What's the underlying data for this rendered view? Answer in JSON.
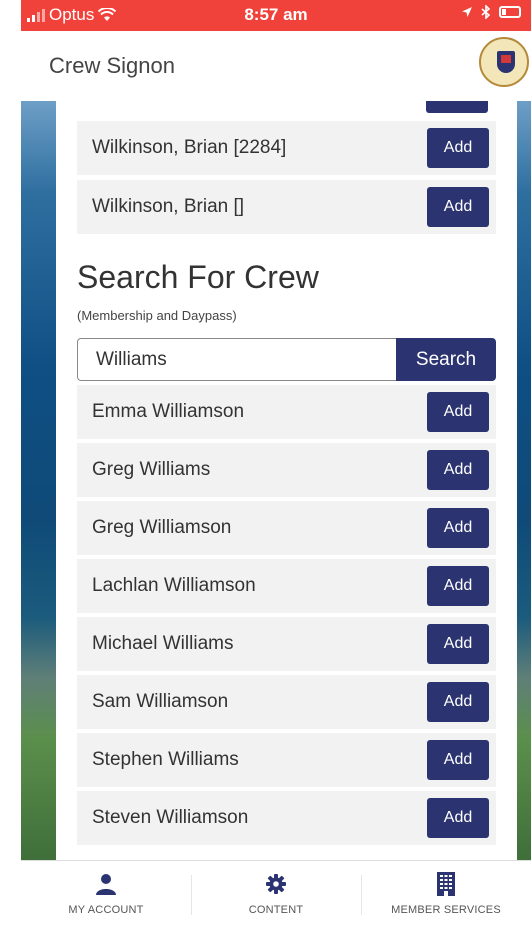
{
  "status_bar": {
    "carrier": "Optus",
    "time": "8:57 am"
  },
  "header": {
    "title": "Crew Signon",
    "logo_icon": "royal-geelong-yacht-club-logo"
  },
  "colors": {
    "status_bar": "#f0413a",
    "button": "#2b3470",
    "row_bg": "#f2f2f3"
  },
  "previous_results": [
    {
      "name": "Wilkinson, Brian [2284]",
      "action": "Add"
    },
    {
      "name": "Wilkinson, Brian []",
      "action": "Add"
    }
  ],
  "search": {
    "title": "Search For Crew",
    "subtitle": "(Membership and Daypass)",
    "query": "Williams",
    "button_label": "Search"
  },
  "results": [
    {
      "name": "Emma Williamson",
      "action": "Add"
    },
    {
      "name": "Greg Williams",
      "action": "Add"
    },
    {
      "name": "Greg Williamson",
      "action": "Add"
    },
    {
      "name": "Lachlan Williamson",
      "action": "Add"
    },
    {
      "name": "Michael Williams",
      "action": "Add"
    },
    {
      "name": "Sam Williamson",
      "action": "Add"
    },
    {
      "name": "Stephen Williams",
      "action": "Add"
    },
    {
      "name": "Steven Williamson",
      "action": "Add"
    }
  ],
  "bottom_nav": [
    {
      "label": "MY ACCOUNT",
      "icon": "user-icon"
    },
    {
      "label": "CONTENT",
      "icon": "gear-icon"
    },
    {
      "label": "MEMBER SERVICES",
      "icon": "building-icon"
    }
  ]
}
